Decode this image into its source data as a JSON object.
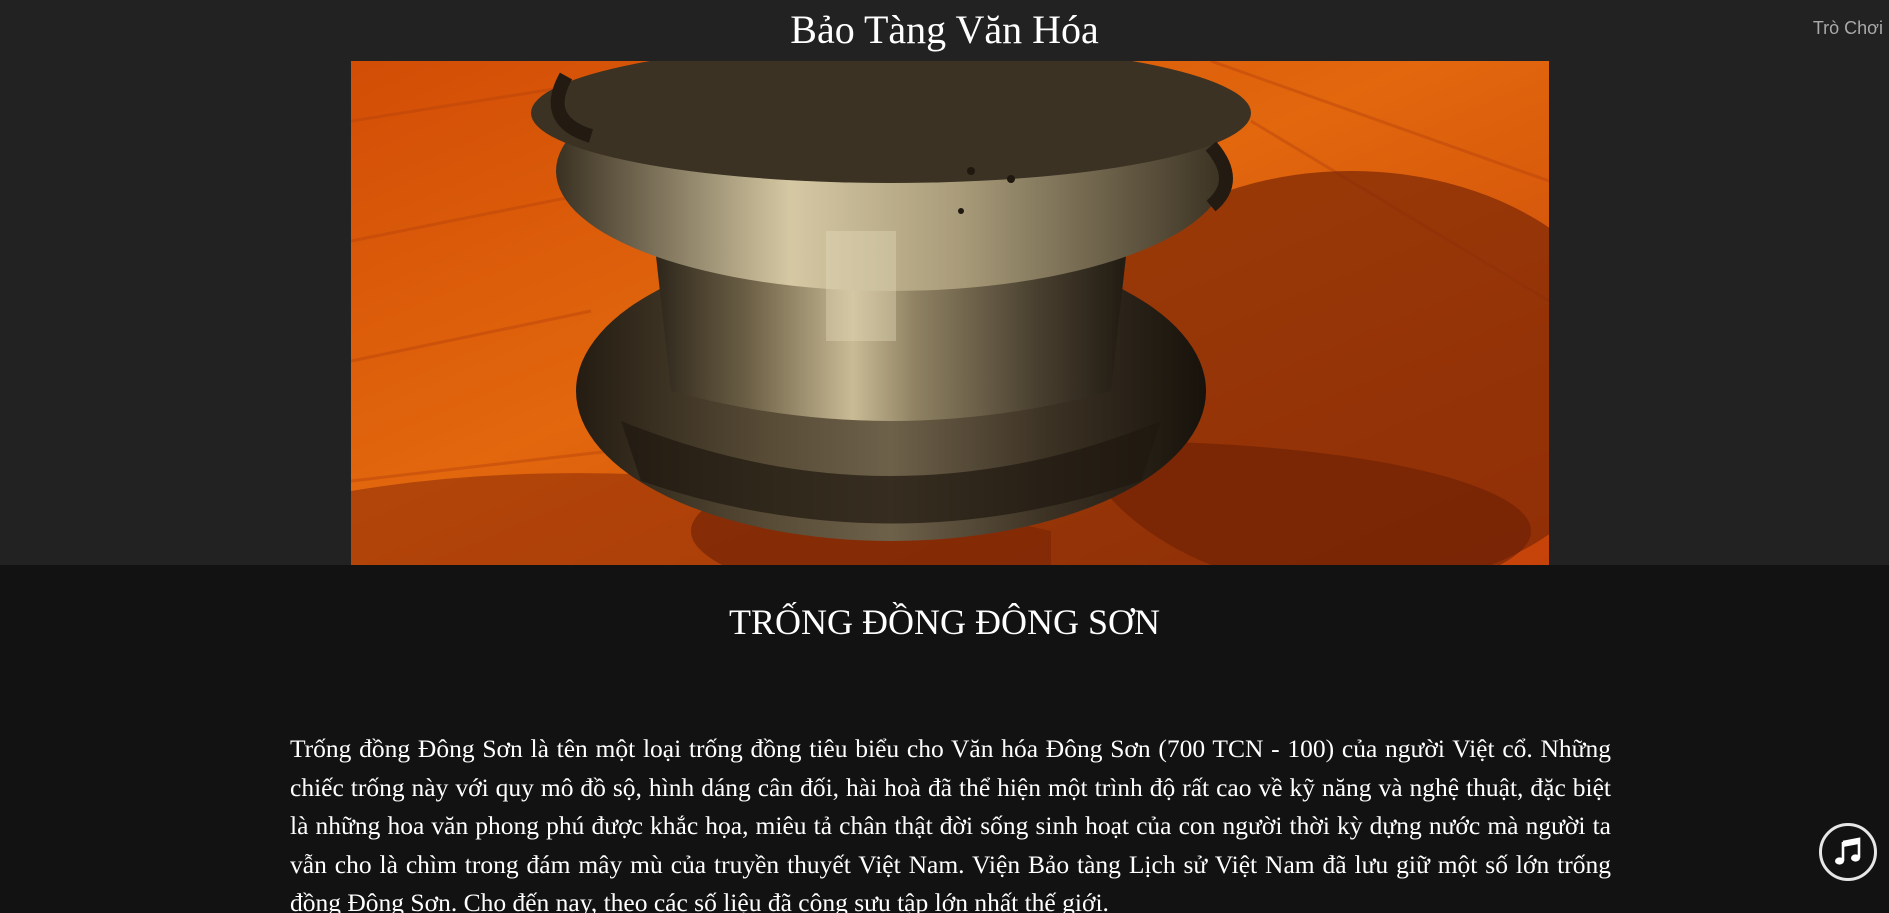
{
  "header": {
    "title": "Bảo Tàng Văn Hóa",
    "nav_link_label": "Trò Chơi"
  },
  "hero": {
    "image_icon": "bronze-drum-photo"
  },
  "article": {
    "title": "TRỐNG ĐỒNG ĐÔNG SƠN",
    "body": "Trống đồng Đông Sơn là tên một loại trống đồng tiêu biểu cho Văn hóa Đông Sơn (700 TCN - 100) của người Việt cổ. Những chiếc trống này với quy mô đồ sộ, hình dáng cân đối, hài hoà đã thể hiện một trình độ rất cao về kỹ năng và nghệ thuật, đặc biệt là những hoa văn phong phú được khắc họa, miêu tả chân thật đời sống sinh hoạt của con người thời kỳ dựng nước mà người ta vẫn cho là chìm trong đám mây mù của truyền thuyết Việt Nam. Viện Bảo tàng Lịch sử Việt Nam đã lưu giữ một số lớn trống đồng Đông Sơn. Cho đến nay, theo các số liệu đã công sưu tập lớn nhất thế giới."
  },
  "music_button": {
    "icon": "music-note-icon"
  },
  "colors": {
    "page_background": "#121212",
    "header_background": "#222222",
    "title_text": "#ffffff",
    "nav_text": "#a9a9a9"
  }
}
